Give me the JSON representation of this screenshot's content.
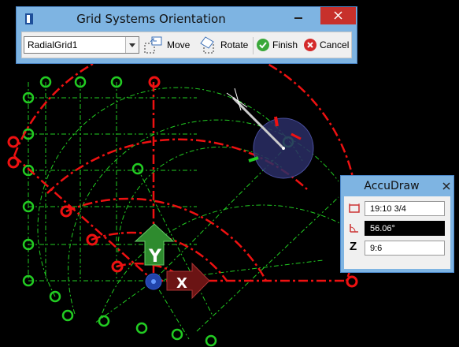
{
  "dialog": {
    "title": "Grid Systems Orientation",
    "grid_select_value": "RadialGrid1",
    "move_label": "Move",
    "rotate_label": "Rotate",
    "finish_label": "Finish",
    "cancel_label": "Cancel"
  },
  "accudraw": {
    "title": "AccuDraw",
    "distance_value": "19:10 3/4",
    "angle_value": "56.06°",
    "z_label": "Z",
    "z_value": "9:6"
  },
  "view": {
    "y_axis_label": "Y",
    "x_axis_label": "X"
  },
  "colors": {
    "background": "#000000",
    "grid_green": "#22cc22",
    "radial_red": "#ee1111",
    "window_blue": "#7eb4e2",
    "y_arrow": "#2e8b2e",
    "x_arrow": "#8b1a1a"
  }
}
